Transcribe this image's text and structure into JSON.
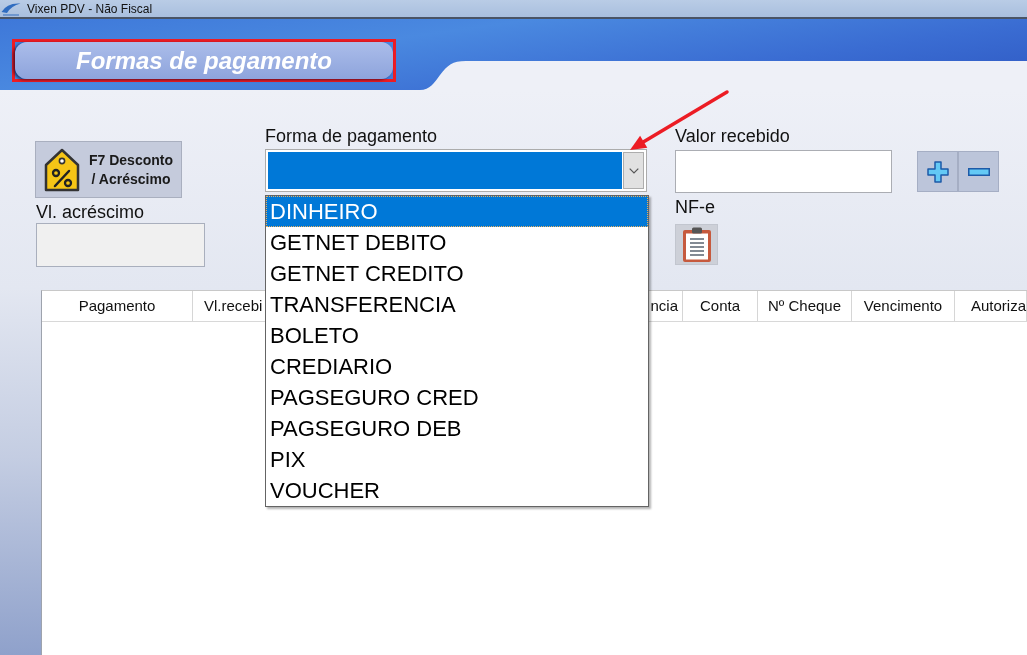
{
  "window": {
    "title": "Vixen PDV - Não Fiscal"
  },
  "header": {
    "title": "Formas de pagamento"
  },
  "discount_button": {
    "lines": [
      "F7 Desconto",
      "/ Acréscimo"
    ]
  },
  "surcharge_field": {
    "label": "Vl. acréscimo"
  },
  "payment_method": {
    "label": "Forma de pagamento",
    "focused": true,
    "expanded": true,
    "options": [
      {
        "label": "DINHEIRO",
        "selected": true
      },
      {
        "label": "GETNET DEBITO",
        "selected": false
      },
      {
        "label": "GETNET CREDITO",
        "selected": false
      },
      {
        "label": "TRANSFERENCIA",
        "selected": false
      },
      {
        "label": "BOLETO",
        "selected": false
      },
      {
        "label": "CREDIARIO",
        "selected": false
      },
      {
        "label": "PAGSEGURO CRED",
        "selected": false
      },
      {
        "label": "PAGSEGURO DEB",
        "selected": false
      },
      {
        "label": "PIX",
        "selected": false
      },
      {
        "label": "VOUCHER",
        "selected": false
      }
    ]
  },
  "amount_field": {
    "label": "Valor recebido"
  },
  "amount_buttons": [
    {
      "kind": "add"
    },
    {
      "kind": "remove"
    }
  ],
  "nfe": {
    "label": "NF-e"
  },
  "table": {
    "columns": [
      {
        "label": "Pagamento"
      },
      {
        "label": "Vl.recebi"
      },
      {
        "label": "ncia"
      },
      {
        "label": "Conta"
      },
      {
        "label": "Nº Cheque"
      },
      {
        "label": "Vencimento"
      },
      {
        "label": "Autoriza"
      }
    ]
  },
  "annotations": {
    "title_frame": true,
    "dropdown_arrow": true
  }
}
